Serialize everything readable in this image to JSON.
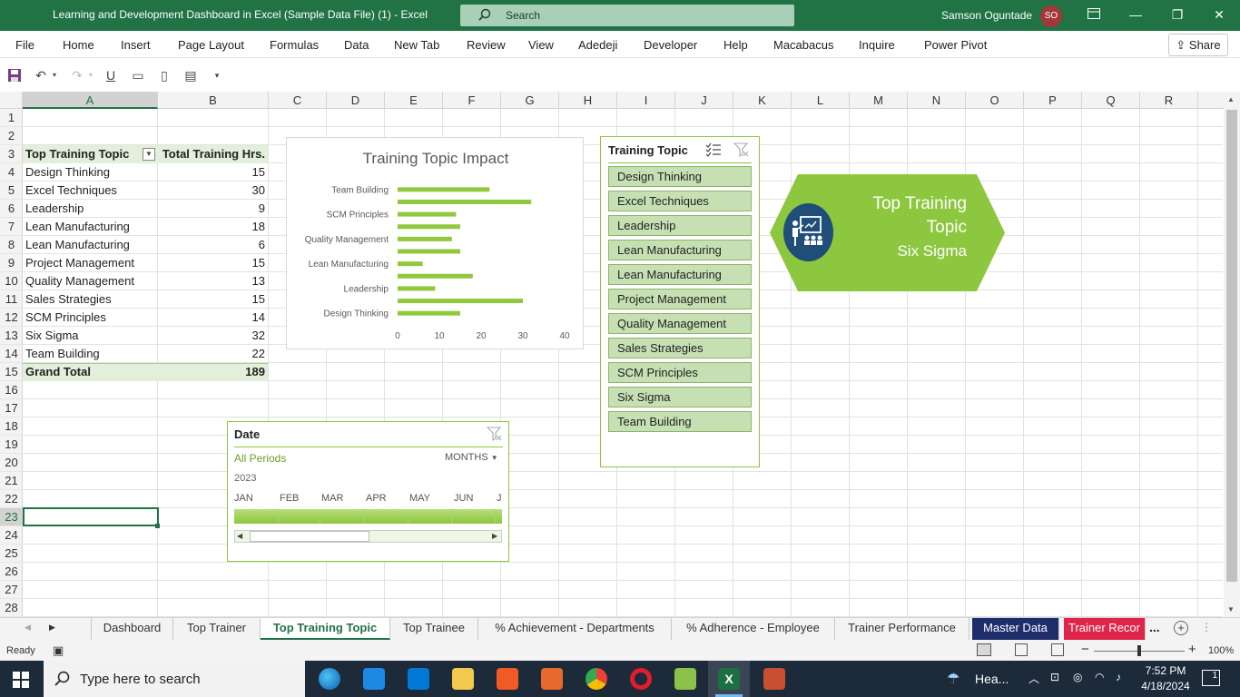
{
  "window": {
    "title": "Learning and Development Dashboard in Excel (Sample Data File) (1)  -  Excel",
    "search_placeholder": "Search",
    "user_name": "Samson Oguntade",
    "user_initials": "SO",
    "ribbon_display_icon": "ribbon-display-icon",
    "minimize_glyph": "—",
    "restore_glyph": "❐",
    "close_glyph": "✕"
  },
  "menu": {
    "items": [
      "File",
      "Home",
      "Insert",
      "Page Layout",
      "Formulas",
      "Data",
      "New Tab",
      "Review",
      "View",
      "Adedeji",
      "Developer",
      "Help",
      "Macabacus",
      "Inquire",
      "Power Pivot"
    ],
    "share_label": "Share"
  },
  "grid": {
    "columns": [
      "A",
      "B",
      "C",
      "D",
      "E",
      "F",
      "G",
      "H",
      "I",
      "J",
      "K",
      "L",
      "M",
      "N",
      "O",
      "P",
      "Q",
      "R"
    ],
    "rows": [
      "1",
      "2",
      "3",
      "4",
      "5",
      "6",
      "7",
      "8",
      "9",
      "10",
      "11",
      "12",
      "13",
      "14",
      "15",
      "16",
      "17",
      "18",
      "19",
      "20",
      "21",
      "22",
      "23",
      "24",
      "25",
      "26",
      "27",
      "28"
    ],
    "selected_cell": "A23"
  },
  "pivot": {
    "header_topic": "Top Training Topic",
    "header_hours": "Total Training Hrs.",
    "rows": [
      {
        "topic": "Design Thinking",
        "hours": "15"
      },
      {
        "topic": "Excel Techniques",
        "hours": "30"
      },
      {
        "topic": "Leadership",
        "hours": "9"
      },
      {
        "topic": "Lean Manufacturing",
        "hours": "18"
      },
      {
        "topic": "Lean Manufacturing",
        "hours": "6"
      },
      {
        "topic": "Project Management",
        "hours": "15"
      },
      {
        "topic": "Quality Management",
        "hours": "13"
      },
      {
        "topic": "Sales Strategies",
        "hours": "15"
      },
      {
        "topic": "SCM Principles",
        "hours": "14"
      },
      {
        "topic": "Six Sigma",
        "hours": "32"
      },
      {
        "topic": "Team Building",
        "hours": "22"
      }
    ],
    "grand_total_label": "Grand Total",
    "grand_total_value": "189"
  },
  "chart_data": {
    "type": "bar",
    "orientation": "horizontal",
    "title": "Training Topic Impact",
    "categories": [
      "Design Thinking",
      "Excel Techniques",
      "Leadership",
      "Lean Manufacturing",
      "Lean Manufacturing",
      "Project Management",
      "Quality Management",
      "Sales Strategies",
      "SCM Principles",
      "Six Sigma",
      "Team Building"
    ],
    "visible_category_labels": [
      "Team Building",
      "SCM Principles",
      "Quality Management",
      "Lean Manufacturing",
      "Leadership",
      "Design Thinking"
    ],
    "values": [
      15,
      30,
      9,
      18,
      6,
      15,
      13,
      15,
      14,
      32,
      22
    ],
    "xlim": [
      0,
      40
    ],
    "xticks": [
      "0",
      "10",
      "20",
      "30",
      "40"
    ],
    "bar_color": "#92c83e",
    "grid": false
  },
  "slicer": {
    "title": "Training Topic",
    "multiselect_icon": "multi-select-icon",
    "clear_filter_icon": "clear-filter-icon",
    "items": [
      "Design Thinking",
      "Excel Techniques",
      "Leadership",
      "Lean Manufacturing",
      "Lean Manufacturing",
      "Project Management",
      "Quality Management",
      "Sales Strategies",
      "SCM Principles",
      "Six Sigma",
      "Team Building"
    ]
  },
  "kpi": {
    "line1": "Top Training",
    "line2": "Topic",
    "value": "Six Sigma",
    "icon": "teacher-presentation-icon",
    "fill_color": "#8dc63f"
  },
  "timeline": {
    "title": "Date",
    "periods_label": "All Periods",
    "level_label": "MONTHS",
    "year": "2023",
    "months": [
      "JAN",
      "FEB",
      "MAR",
      "APR",
      "MAY",
      "JUN",
      "J"
    ]
  },
  "tabs": {
    "items": [
      {
        "label": "Dashboard",
        "active": false
      },
      {
        "label": "Top Trainer",
        "active": false
      },
      {
        "label": "Top Training Topic",
        "active": true
      },
      {
        "label": "Top Trainee",
        "active": false
      },
      {
        "label": "% Achievement - Departments",
        "active": false
      },
      {
        "label": "% Adherence - Employee",
        "active": false
      },
      {
        "label": "Trainer Performance",
        "active": false
      },
      {
        "label": "Master Data",
        "active": false
      },
      {
        "label": "Trainer Recor",
        "active": false
      }
    ],
    "more": "...",
    "master_data_color": "#1f2d6b",
    "trainer_rec_color": "#e0254a"
  },
  "status": {
    "ready": "Ready",
    "zoom": "100%"
  },
  "taskbar": {
    "search_placeholder": "Type here to search",
    "weather": "Hea...",
    "time": "7:52 PM",
    "date": "4/18/2024",
    "notifications": "1"
  }
}
